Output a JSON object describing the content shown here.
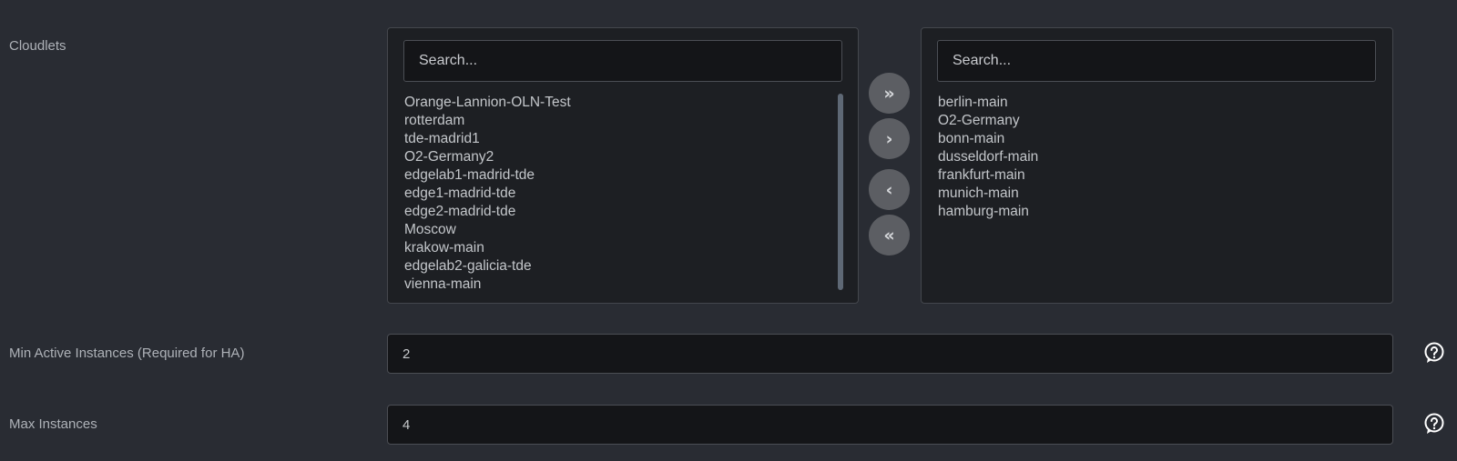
{
  "cloudlets": {
    "label": "Cloudlets",
    "available": {
      "search_placeholder": "Search...",
      "items": [
        "Orange-Lannion-OLN-Test",
        "rotterdam",
        "tde-madrid1",
        "O2-Germany2",
        "edgelab1-madrid-tde",
        "edge1-madrid-tde",
        "edge2-madrid-tde",
        "Moscow",
        "krakow-main",
        "edgelab2-galicia-tde",
        "vienna-main"
      ]
    },
    "selected": {
      "search_placeholder": "Search...",
      "items": [
        "berlin-main",
        "O2-Germany",
        "bonn-main",
        "dusseldorf-main",
        "frankfurt-main",
        "munich-main",
        "hamburg-main"
      ]
    },
    "buttons": {
      "move_all_right": "»",
      "move_right": "›",
      "move_left": "‹",
      "move_all_left": "«"
    }
  },
  "min_active_instances": {
    "label": "Min Active Instances (Required for HA)",
    "value": "2"
  },
  "max_instances": {
    "label": "Max Instances",
    "value": "4"
  },
  "icons": {
    "help": "help-circle-icon"
  }
}
